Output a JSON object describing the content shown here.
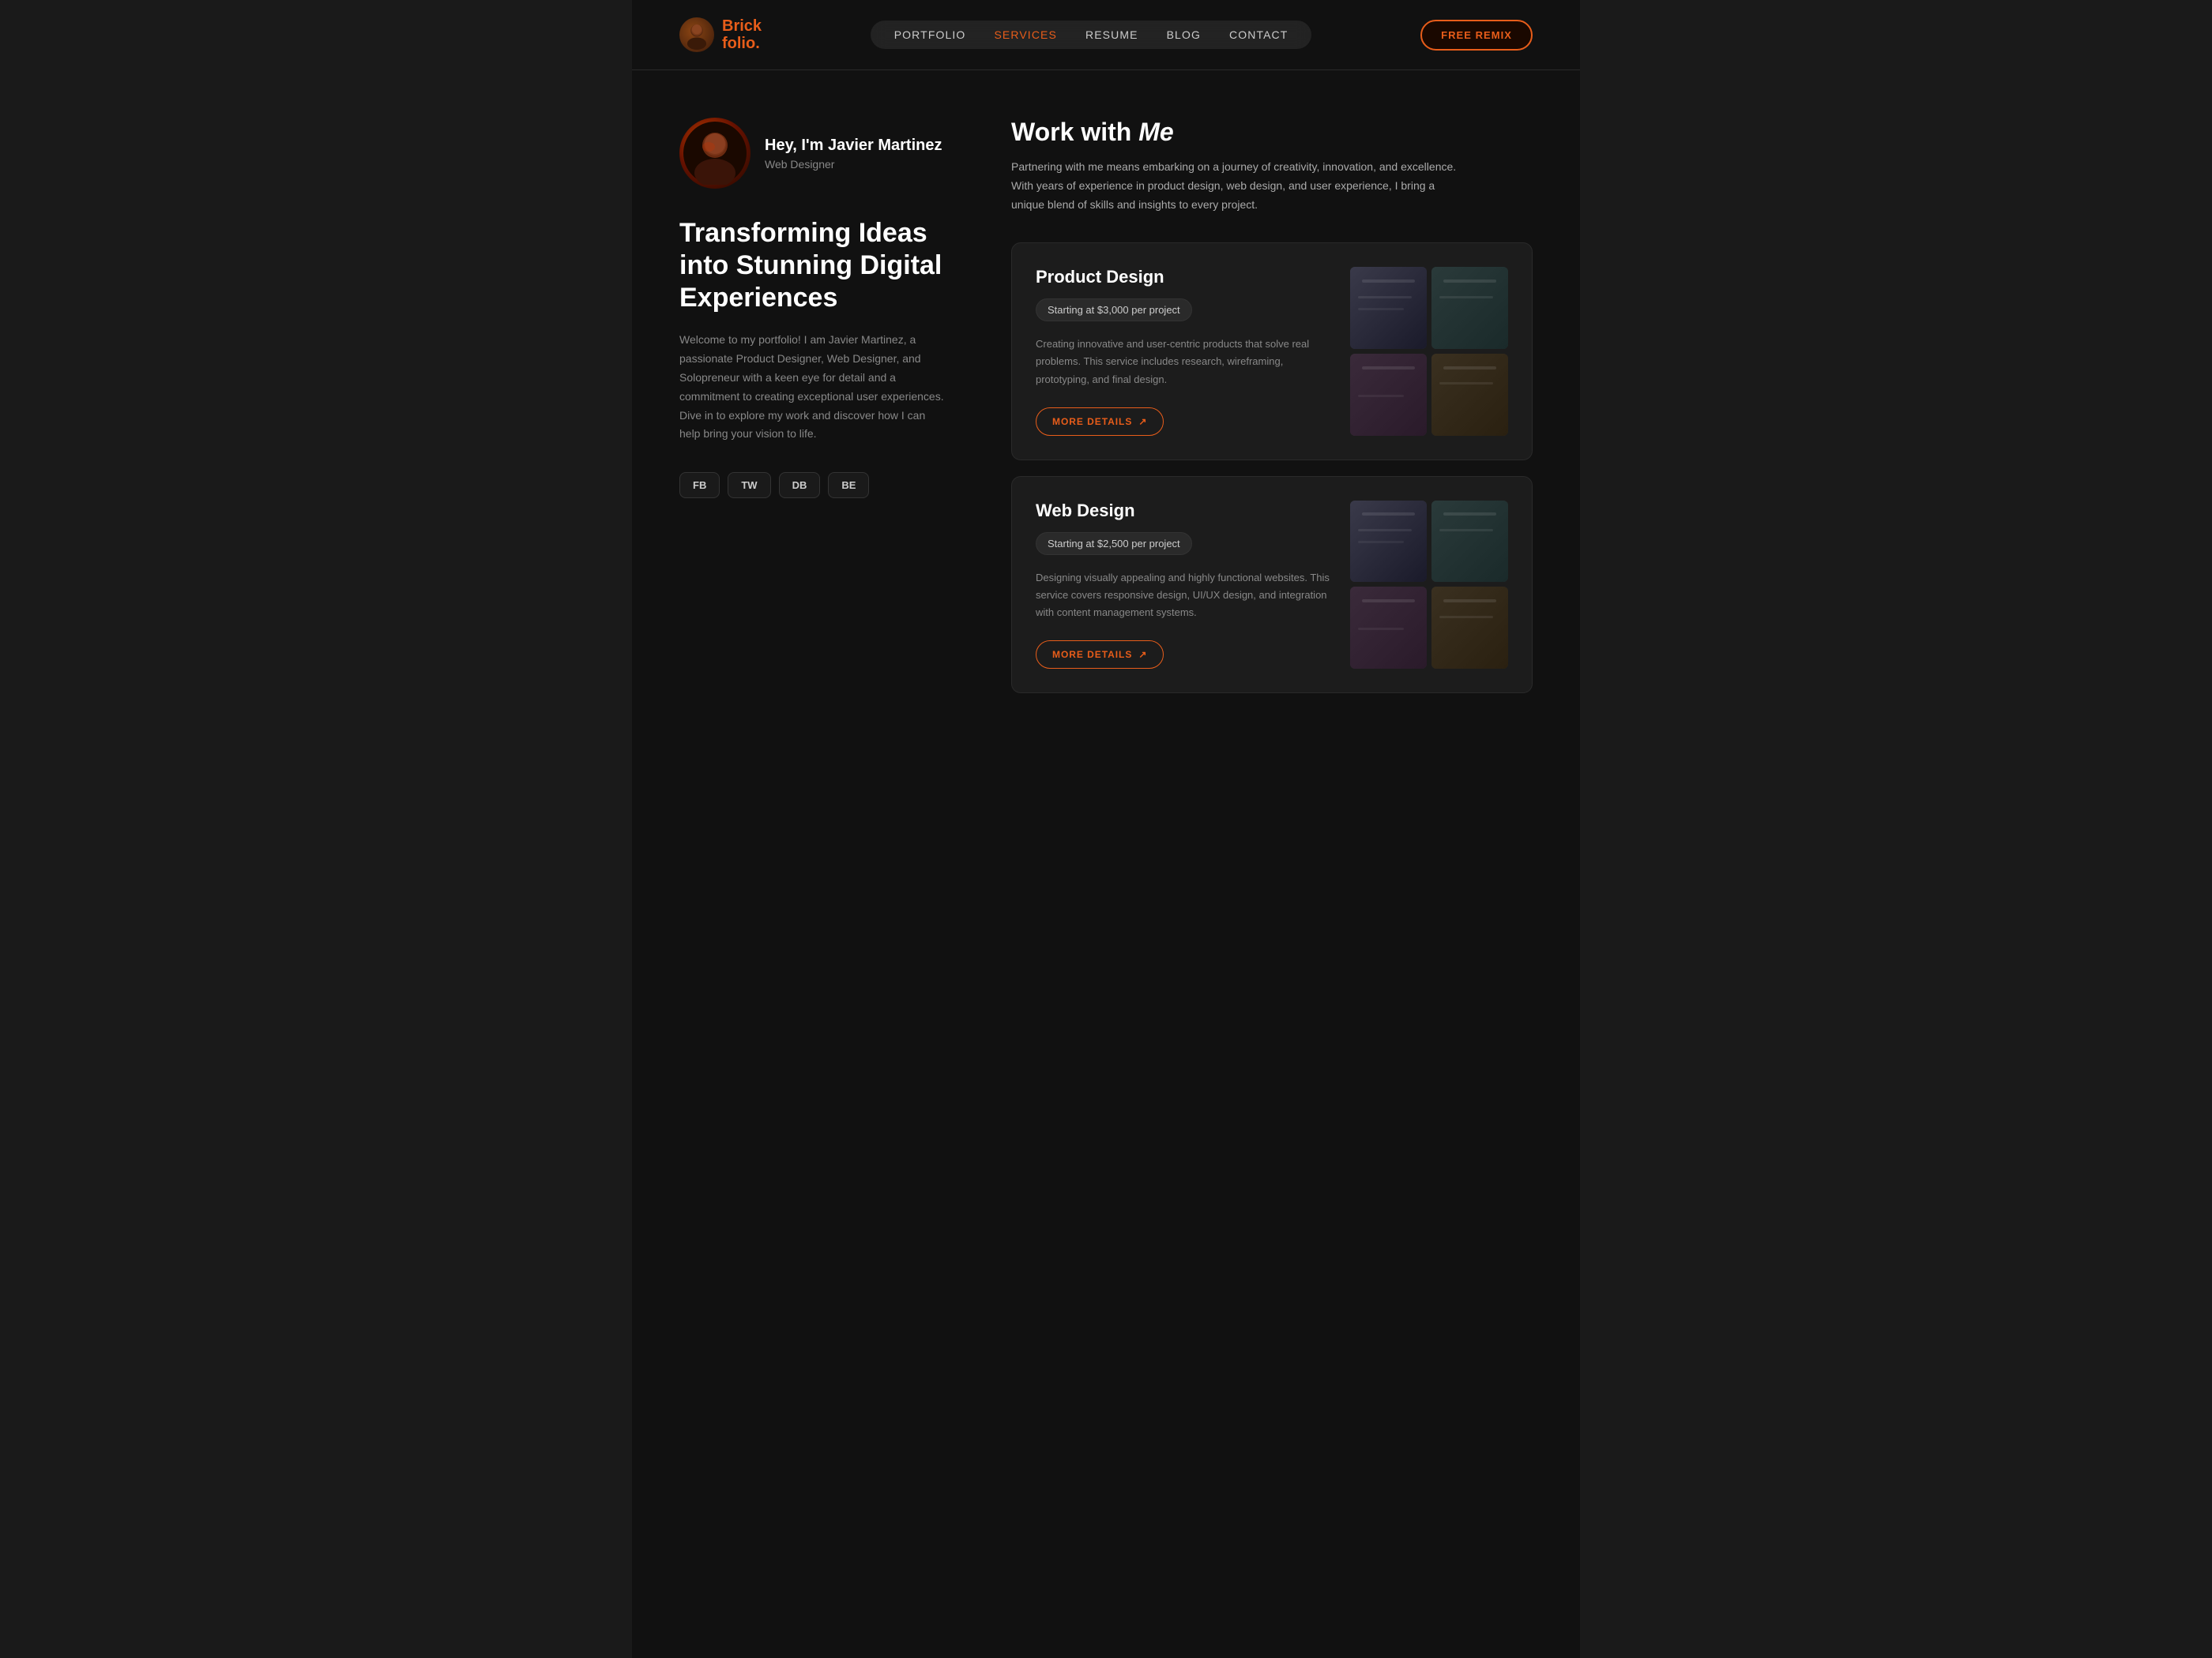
{
  "site": {
    "bg_color": "#111111"
  },
  "header": {
    "logo_name": "Brick",
    "logo_sub": "folio.",
    "nav": {
      "items": [
        {
          "label": "PORTFOLIO",
          "active": false
        },
        {
          "label": "SERVICES",
          "active": true
        },
        {
          "label": "RESUME",
          "active": false
        },
        {
          "label": "BLOG",
          "active": false
        },
        {
          "label": "CONTACT",
          "active": false
        }
      ],
      "cta_label": "FREE REMIX"
    }
  },
  "hero": {
    "profile_name": "Hey, I'm Javier Martinez",
    "profile_role": "Web Designer",
    "heading": "Transforming Ideas into Stunning Digital Experiences",
    "description": "Welcome to my portfolio! I am Javier Martinez, a passionate Product Designer, Web Designer, and Solopreneur with a keen eye for detail and a commitment to creating exceptional user experiences. Dive in to explore my work and discover how I can help bring your vision to life.",
    "social_links": [
      {
        "label": "FB"
      },
      {
        "label": "TW"
      },
      {
        "label": "DB"
      },
      {
        "label": "BE"
      }
    ]
  },
  "work_section": {
    "heading_normal": "Work with ",
    "heading_italic": "Me",
    "description": "Partnering with me means embarking on a journey of creativity, innovation, and excellence. With years of experience in product design, web design, and user experience, I bring a unique blend of skills and insights to every project."
  },
  "services": [
    {
      "title": "Product Design",
      "price": "Starting at $3,000 per project",
      "description": "Creating innovative and user-centric products that solve real problems. This service includes research, wireframing, prototyping, and final design.",
      "cta": "MORE DETAILS"
    },
    {
      "title": "Web Design",
      "price": "Starting at $2,500 per project",
      "description": "Designing visually appealing and highly functional websites. This service covers responsive design, UI/UX design, and integration with content management systems.",
      "cta": "MORE DETAILS"
    }
  ]
}
